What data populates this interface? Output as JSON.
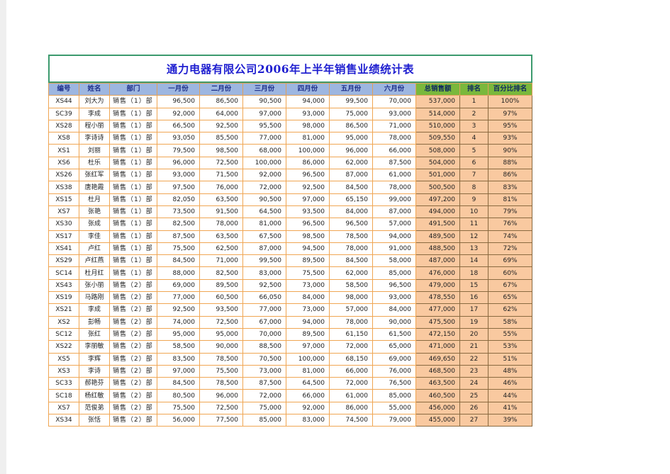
{
  "title": "通力电器有限公司2006年上半年销售业绩统计表",
  "headers": [
    "编号",
    "姓名",
    "部门",
    "一月份",
    "二月份",
    "三月份",
    "四月份",
    "五月份",
    "六月份",
    "总销售额",
    "排名",
    "百分比排名"
  ],
  "rows": [
    [
      "XS44",
      "刘大为",
      "销售（1）部",
      "96,500",
      "86,500",
      "90,500",
      "94,000",
      "99,500",
      "70,000",
      "537,000",
      "1",
      "100%"
    ],
    [
      "SC39",
      "李成",
      "销售（1）部",
      "92,000",
      "64,000",
      "97,000",
      "93,000",
      "75,000",
      "93,000",
      "514,000",
      "2",
      "97%"
    ],
    [
      "XS28",
      "程小丽",
      "销售（1）部",
      "66,500",
      "92,500",
      "95,500",
      "98,000",
      "86,500",
      "71,000",
      "510,000",
      "3",
      "95%"
    ],
    [
      "XS8",
      "李诗诗",
      "销售（1）部",
      "93,050",
      "85,500",
      "77,000",
      "81,000",
      "95,000",
      "78,000",
      "509,550",
      "4",
      "93%"
    ],
    [
      "XS1",
      "刘丽",
      "销售（1）部",
      "79,500",
      "98,500",
      "68,000",
      "100,000",
      "96,000",
      "66,000",
      "508,000",
      "5",
      "90%"
    ],
    [
      "XS6",
      "杜乐",
      "销售（1）部",
      "96,000",
      "72,500",
      "100,000",
      "86,000",
      "62,000",
      "87,500",
      "504,000",
      "6",
      "88%"
    ],
    [
      "XS26",
      "张红军",
      "销售（1）部",
      "93,000",
      "71,500",
      "92,000",
      "96,500",
      "87,000",
      "61,000",
      "501,000",
      "7",
      "86%"
    ],
    [
      "XS38",
      "唐艳霞",
      "销售（1）部",
      "97,500",
      "76,000",
      "72,000",
      "92,500",
      "84,500",
      "78,000",
      "500,500",
      "8",
      "83%"
    ],
    [
      "XS15",
      "杜月",
      "销售（1）部",
      "82,050",
      "63,500",
      "90,500",
      "97,000",
      "65,150",
      "99,000",
      "497,200",
      "9",
      "81%"
    ],
    [
      "XS7",
      "张艳",
      "销售（1）部",
      "73,500",
      "91,500",
      "64,500",
      "93,500",
      "84,000",
      "87,000",
      "494,000",
      "10",
      "79%"
    ],
    [
      "XS30",
      "张成",
      "销售（1）部",
      "82,500",
      "78,000",
      "81,000",
      "96,500",
      "96,500",
      "57,000",
      "491,500",
      "11",
      "76%"
    ],
    [
      "XS17",
      "李佳",
      "销售（1）部",
      "87,500",
      "63,500",
      "67,500",
      "98,500",
      "78,500",
      "94,000",
      "489,500",
      "12",
      "74%"
    ],
    [
      "XS41",
      "卢红",
      "销售（1）部",
      "75,500",
      "62,500",
      "87,000",
      "94,500",
      "78,000",
      "91,000",
      "488,500",
      "13",
      "72%"
    ],
    [
      "XS29",
      "卢红燕",
      "销售（1）部",
      "84,500",
      "71,000",
      "99,500",
      "89,500",
      "84,500",
      "58,000",
      "487,000",
      "14",
      "69%"
    ],
    [
      "SC14",
      "杜月红",
      "销售（1）部",
      "88,000",
      "82,500",
      "83,000",
      "75,500",
      "62,000",
      "85,000",
      "476,000",
      "18",
      "60%"
    ],
    [
      "XS43",
      "张小丽",
      "销售（2）部",
      "69,000",
      "89,500",
      "92,500",
      "73,000",
      "58,500",
      "96,500",
      "479,000",
      "15",
      "67%"
    ],
    [
      "XS19",
      "马路刚",
      "销售（2）部",
      "77,000",
      "60,500",
      "66,050",
      "84,000",
      "98,000",
      "93,000",
      "478,550",
      "16",
      "65%"
    ],
    [
      "XS21",
      "李成",
      "销售（2）部",
      "92,500",
      "93,500",
      "77,000",
      "73,000",
      "57,000",
      "84,000",
      "477,000",
      "17",
      "62%"
    ],
    [
      "XS2",
      "彭畅",
      "销售（2）部",
      "74,000",
      "72,500",
      "67,000",
      "94,000",
      "78,000",
      "90,000",
      "475,500",
      "19",
      "58%"
    ],
    [
      "SC12",
      "张红",
      "销售（2）部",
      "95,000",
      "95,000",
      "70,000",
      "89,500",
      "61,150",
      "61,500",
      "472,150",
      "20",
      "55%"
    ],
    [
      "XS22",
      "李丽敏",
      "销售（2）部",
      "58,500",
      "90,000",
      "88,500",
      "97,000",
      "72,000",
      "65,000",
      "471,000",
      "21",
      "53%"
    ],
    [
      "XS5",
      "李辉",
      "销售（2）部",
      "83,500",
      "78,500",
      "70,500",
      "100,000",
      "68,150",
      "69,000",
      "469,650",
      "22",
      "51%"
    ],
    [
      "XS3",
      "李诗",
      "销售（2）部",
      "97,000",
      "75,500",
      "73,000",
      "81,000",
      "66,000",
      "76,000",
      "468,500",
      "23",
      "48%"
    ],
    [
      "SC33",
      "郝艳芬",
      "销售（2）部",
      "84,500",
      "78,500",
      "87,500",
      "64,500",
      "72,000",
      "76,500",
      "463,500",
      "24",
      "46%"
    ],
    [
      "SC18",
      "杨红敏",
      "销售（2）部",
      "80,500",
      "96,000",
      "72,000",
      "66,000",
      "61,000",
      "85,000",
      "460,500",
      "25",
      "44%"
    ],
    [
      "XS7",
      "范俊弟",
      "销售（2）部",
      "75,500",
      "72,500",
      "75,000",
      "92,000",
      "86,000",
      "55,000",
      "456,000",
      "26",
      "41%"
    ],
    [
      "XS34",
      "张恬",
      "销售（2）部",
      "56,000",
      "77,500",
      "85,000",
      "83,000",
      "74,500",
      "79,000",
      "455,000",
      "27",
      "39%"
    ]
  ]
}
